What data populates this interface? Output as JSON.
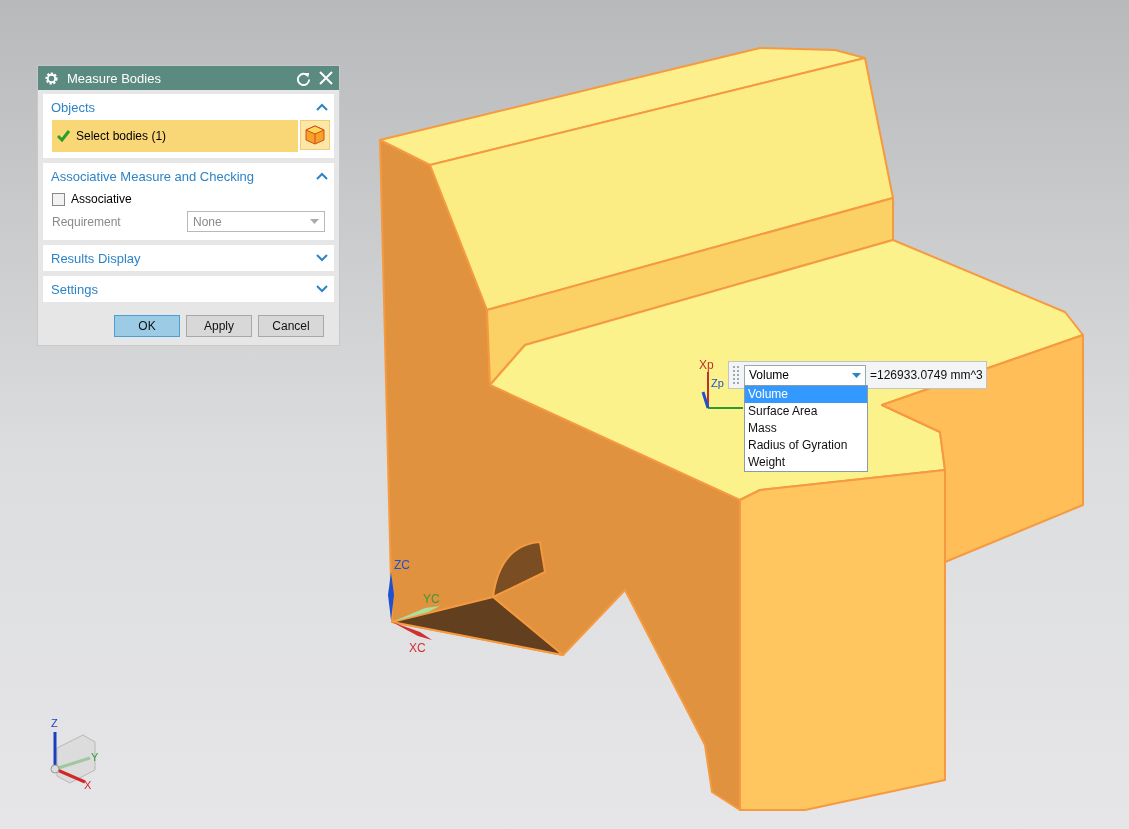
{
  "dialog": {
    "title": "Measure Bodies",
    "objects": {
      "title": "Objects",
      "expanded": true,
      "selection": "Select bodies (1)",
      "complete": true
    },
    "associative": {
      "title": "Associative Measure and Checking",
      "expanded": true,
      "checkbox": {
        "label": "Associative",
        "checked": false
      },
      "requirement": {
        "label": "Requirement",
        "value": "None",
        "disabled": true
      }
    },
    "results_display": {
      "title": "Results Display",
      "expanded": false
    },
    "settings": {
      "title": "Settings",
      "expanded": false
    },
    "buttons": [
      {
        "label": "OK",
        "default": true
      },
      {
        "label": "Apply",
        "default": false
      },
      {
        "label": "Cancel",
        "default": false
      }
    ]
  },
  "measurement": {
    "quantity": "Volume",
    "result": "=126933.0749 mm^3",
    "options": [
      {
        "label": "Volume",
        "selected": true
      },
      {
        "label": "Surface Area",
        "selected": false
      },
      {
        "label": "Mass",
        "selected": false
      },
      {
        "label": "Radius of Gyration",
        "selected": false
      },
      {
        "label": "Weight",
        "selected": false
      }
    ]
  },
  "point_csys": {
    "x": "Xp",
    "z": "Zp"
  },
  "work_csys": {
    "x": "XC",
    "y": "YC",
    "z": "ZC"
  },
  "view_triad": {
    "x": "X",
    "y": "Y",
    "z": "Z"
  }
}
